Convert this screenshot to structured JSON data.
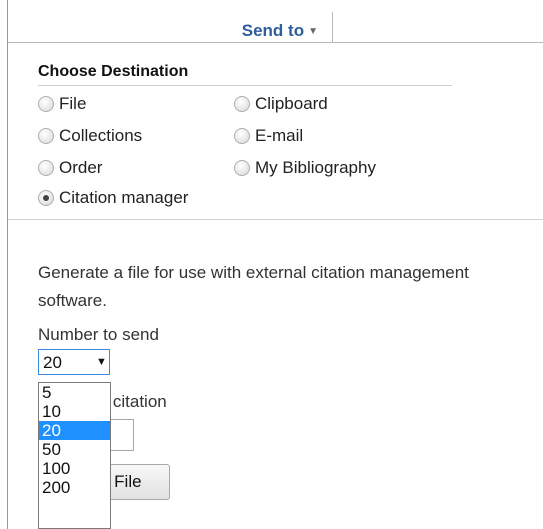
{
  "header": {
    "send_to_label": "Send to"
  },
  "destination": {
    "heading": "Choose Destination",
    "options": [
      {
        "label": "File",
        "checked": false
      },
      {
        "label": "Clipboard",
        "checked": false
      },
      {
        "label": "Collections",
        "checked": false
      },
      {
        "label": "E-mail",
        "checked": false
      },
      {
        "label": "Order",
        "checked": false
      },
      {
        "label": "My Bibliography",
        "checked": false
      },
      {
        "label": "Citation manager",
        "checked": true
      }
    ]
  },
  "citation": {
    "description": "Generate a file for use with external citation management software.",
    "number_label": "Number to send",
    "number_value": "20",
    "from_label": "m citation",
    "create_button_label": "e File"
  },
  "number_dropdown": {
    "options": [
      "5",
      "10",
      "20",
      "50",
      "100",
      "200"
    ],
    "selected": "20"
  },
  "colors": {
    "link_blue": "#2f5e9c",
    "selection_blue": "#1e90ff",
    "focus_border": "#3c8be0"
  }
}
